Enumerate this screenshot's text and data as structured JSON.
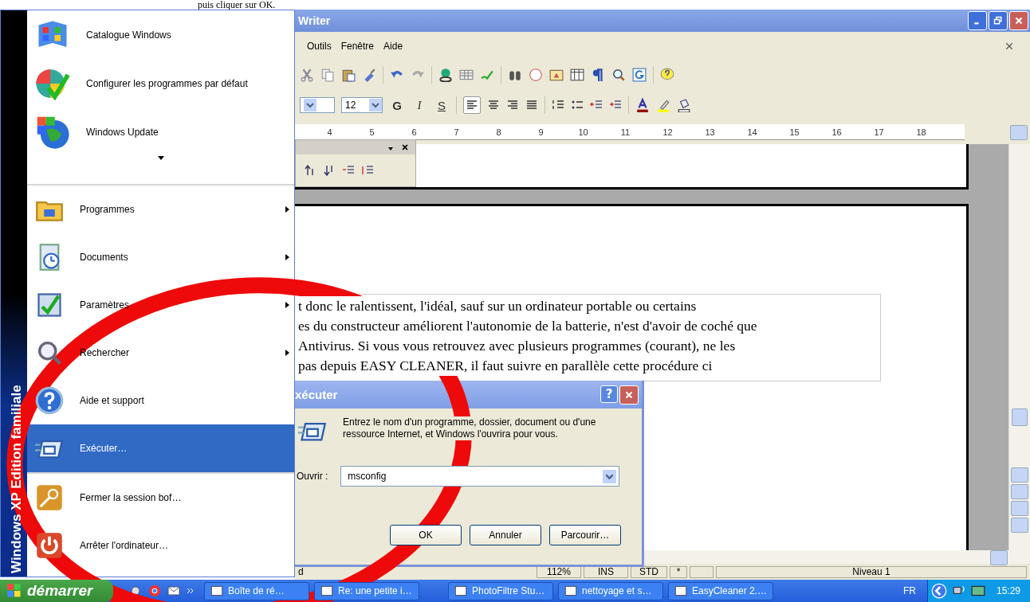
{
  "page_caption": "puis cliquer sur OK.",
  "writer": {
    "title": "Writer",
    "menu": [
      {
        "label": "Outils"
      },
      {
        "label": "Fenêtre"
      },
      {
        "label": "Aide"
      }
    ],
    "font_size": "12",
    "format_buttons": [
      {
        "label": "G",
        "kind": "bold"
      },
      {
        "label": "I",
        "kind": "italic"
      },
      {
        "label": "S",
        "kind": "underline"
      }
    ],
    "ruler_marks": [
      "4",
      "5",
      "6",
      "7",
      "8",
      "9",
      "10",
      "11",
      "12",
      "13",
      "14",
      "15",
      "16",
      "17",
      "18"
    ],
    "document_lines": [
      "t donc le ralentissent, l'idéal, sauf sur un ordinateur portable ou certains",
      "es du constructeur améliorent l'autonomie de la batterie, n'est d'avoir de coché que",
      "Antivirus. Si vous vous retrouvez avec plusieurs programmes (courant), ne les",
      "pas depuis EASY CLEANER, il faut suivre en parallèle cette procédure ci"
    ],
    "status_bar": {
      "page": "d",
      "zoom": "112%",
      "mode": "INS",
      "selection": "STD",
      "modified": "*",
      "outline_level": "Niveau 1"
    }
  },
  "start_menu": {
    "banner": "Windows XP Edition familiale",
    "pinned": [
      {
        "label": "Catalogue Windows",
        "selected": false
      },
      {
        "label": "Configurer les programmes par défaut",
        "selected": false
      },
      {
        "label": "Windows Update",
        "selected": false
      }
    ],
    "items": [
      {
        "label": "Programmes",
        "has_submenu": true,
        "selected": false
      },
      {
        "label": "Documents",
        "has_submenu": true,
        "selected": false
      },
      {
        "label": "Paramètres",
        "has_submenu": true,
        "selected": false
      },
      {
        "label": "Rechercher",
        "has_submenu": true,
        "selected": false
      },
      {
        "label": "Aide et support",
        "has_submenu": false,
        "selected": false
      },
      {
        "label": "Exécuter…",
        "has_submenu": false,
        "selected": true
      }
    ],
    "session": [
      {
        "label": "Fermer la session bof…",
        "selected": false
      },
      {
        "label": "Arrêter l'ordinateur…",
        "selected": false
      }
    ]
  },
  "run_dialog": {
    "title": "xécuter",
    "help_button": "?",
    "message": "Entrez le nom d'un programme, dossier, document ou d'une ressource Internet, et Windows l'ouvrira pour vous.",
    "open_label": "Ouvrir :",
    "value": "msconfig",
    "buttons": [
      "OK",
      "Annuler",
      "Parcourir…"
    ]
  },
  "taskbar": {
    "start_label": "démarrer",
    "tasks": [
      {
        "label": "Boîte de ré…",
        "selected": false
      },
      {
        "label": "Re: une petite i…",
        "selected": false
      },
      {
        "label": "PhotoFiltre Stu…",
        "selected": false
      },
      {
        "label": "nettoyage et s…",
        "selected": false
      },
      {
        "label": "EasyCleaner 2.…",
        "selected": false
      }
    ],
    "language": "FR",
    "clock": "15:29"
  }
}
